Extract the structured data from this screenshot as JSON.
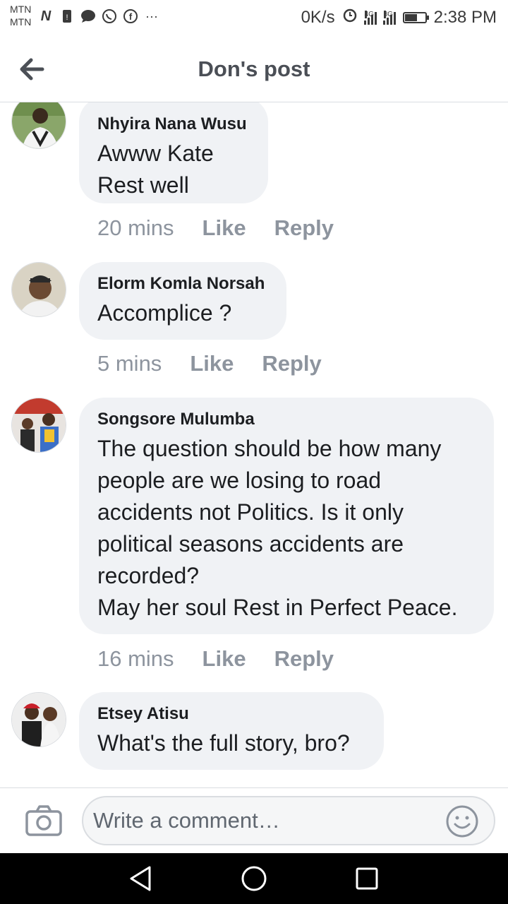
{
  "status_bar": {
    "carriers": [
      "MTN",
      "MTN"
    ],
    "notification_icons": [
      "n-app-icon",
      "sim-icon",
      "chat-icon",
      "whatsapp-icon",
      "facebook-icon",
      "more-icon"
    ],
    "more_indicator": "···",
    "net_speed": "0K/s",
    "network_1": "4G",
    "network_2": "3G",
    "battery_level": 0.6,
    "time": "2:38 PM"
  },
  "header": {
    "title": "Don's post"
  },
  "comments": [
    {
      "author": "Nhyira Nana Wusu",
      "text": "Awww Kate\nRest well",
      "time": "20 mins",
      "like_label": "Like",
      "reply_label": "Reply"
    },
    {
      "author": "Elorm Komla Norsah",
      "text": "Accomplice ?",
      "time": "5 mins",
      "like_label": "Like",
      "reply_label": "Reply"
    },
    {
      "author": "Songsore Mulumba",
      "text": "The question should be how many\npeople are we losing to road\naccidents not Politics. Is it only\npolitical seasons accidents are\nrecorded?\nMay her soul Rest in Perfect Peace.",
      "time": "16 mins",
      "like_label": "Like",
      "reply_label": "Reply"
    },
    {
      "author": "Etsey Atisu",
      "text": "What's the full story, bro?",
      "time": "",
      "like_label": "",
      "reply_label": ""
    }
  ],
  "composer": {
    "placeholder": "Write a comment…"
  },
  "colors": {
    "bubble": "#f0f2f5",
    "meta_text": "#8d949e",
    "header_title": "#4b4f56",
    "nav_bar": "#000000"
  }
}
